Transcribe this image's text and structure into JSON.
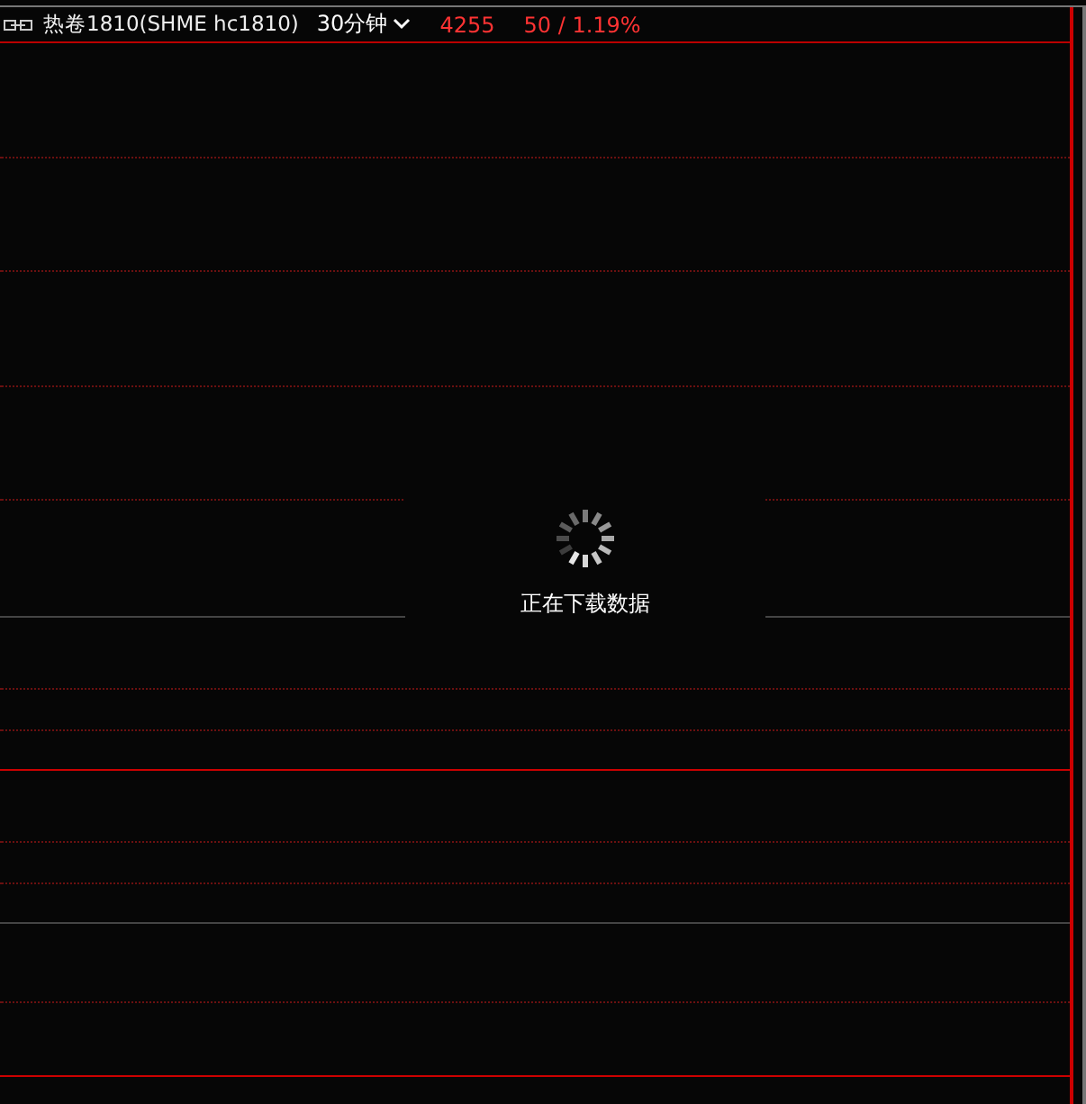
{
  "header": {
    "title": "热卷1810(SHME hc1810)",
    "period": "30分钟",
    "price": "4255",
    "change": "50 / 1.19%"
  },
  "loading": {
    "message": "正在下载数据"
  }
}
